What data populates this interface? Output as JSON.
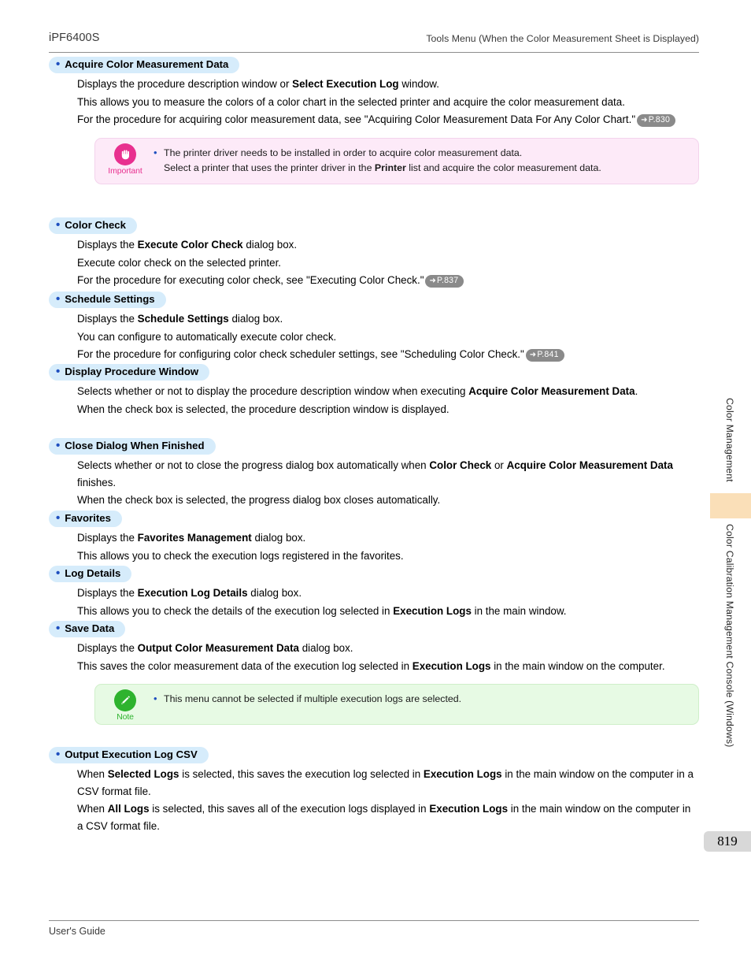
{
  "header": {
    "product": "iPF6400S",
    "chapter": "Tools Menu (When the Color Measurement Sheet is Displayed)"
  },
  "footer": {
    "label": "User's Guide",
    "page_number": "819"
  },
  "sidebar": {
    "tab_label_upper": "Color Management",
    "tab_label_lower": "Color Calibration Management Console (Windows)",
    "tab_color": "#fadfb8"
  },
  "colors": {
    "heading_pill": "#d6ecfb",
    "bullet_blue": "#1f4fbf",
    "important_bg": "#fdeaf8",
    "important_accent": "#e8308f",
    "note_bg": "#e7fae4",
    "note_accent": "#2eb32e",
    "ref_badge": "#8a8a8a",
    "page_number_bg": "#d8d8d8"
  },
  "sections": {
    "acquire": {
      "title": "Acquire Color Measurement Data",
      "line1_a": "Displays the procedure description window or ",
      "line1_b": "Select Execution Log",
      "line1_c": " window.",
      "line2": "This allows you to measure the colors of a color chart in the selected printer and acquire the color measurement data.",
      "line3": "For the procedure for acquiring color measurement data, see \"Acquiring Color Measurement Data For Any Color Chart.\"",
      "ref": "P.830"
    },
    "important": {
      "icon_label": "Important",
      "line1": "The printer driver needs to be installed in order to acquire color measurement data.",
      "line2_a": "Select a printer that uses the printer driver in the ",
      "line2_b": "Printer",
      "line2_c": " list and acquire the color measurement data."
    },
    "color_check": {
      "title": "Color Check",
      "line1_a": "Displays the ",
      "line1_b": "Execute Color Check",
      "line1_c": " dialog box.",
      "line2": "Execute color check on the selected printer.",
      "line3": "For the procedure for executing color check, see \"Executing Color Check.\"",
      "ref": "P.837"
    },
    "schedule": {
      "title": "Schedule Settings",
      "line1_a": "Displays the ",
      "line1_b": "Schedule Settings",
      "line1_c": " dialog box.",
      "line2": "You can configure to automatically execute color check.",
      "line3": "For the procedure for configuring color check scheduler settings, see \"Scheduling Color Check.\"",
      "ref": "P.841"
    },
    "display_procedure": {
      "title": "Display Procedure Window",
      "line1_a": "Selects whether or not to display the procedure description window when executing ",
      "line1_b": "Acquire Color Measurement Data",
      "line1_c": ".",
      "line2": "When the check box is selected, the procedure description window is displayed."
    },
    "close_dialog": {
      "title": "Close Dialog When Finished",
      "line1_a": "Selects whether or not to close the progress dialog box automatically when ",
      "line1_b": "Color Check",
      "line1_c": " or ",
      "line1_d": "Acquire Color Measurement Data",
      "line1_e": " finishes.",
      "line2": "When the check box is selected, the progress dialog box closes automatically."
    },
    "favorites": {
      "title": "Favorites",
      "line1_a": "Displays the ",
      "line1_b": "Favorites Management",
      "line1_c": " dialog box.",
      "line2": "This allows you to check the execution logs registered in the favorites."
    },
    "log_details": {
      "title": "Log Details",
      "line1_a": "Displays the ",
      "line1_b": "Execution Log Details",
      "line1_c": " dialog box.",
      "line2_a": "This allows you to check the details of the execution log selected in ",
      "line2_b": "Execution Logs",
      "line2_c": " in the main window."
    },
    "save_data": {
      "title": "Save Data",
      "line1_a": "Displays the ",
      "line1_b": "Output Color Measurement Data",
      "line1_c": " dialog box.",
      "line2_a": "This saves the color measurement data of the execution log selected in ",
      "line2_b": "Execution Logs",
      "line2_c": " in the main window on the computer."
    },
    "note": {
      "icon_label": "Note",
      "line1": "This menu cannot be selected if multiple execution logs are selected."
    },
    "csv": {
      "title": "Output Execution Log CSV",
      "line1_a": "When ",
      "line1_b": "Selected Logs",
      "line1_c": " is selected, this saves the execution log selected in ",
      "line1_d": "Execution Logs",
      "line1_e": " in the main window on the computer in a CSV format file.",
      "line2_a": "When ",
      "line2_b": "All Logs",
      "line2_c": " is selected, this saves all of the execution logs displayed in ",
      "line2_d": "Execution Logs",
      "line2_e": " in the main window on the computer in a CSV format file."
    }
  }
}
